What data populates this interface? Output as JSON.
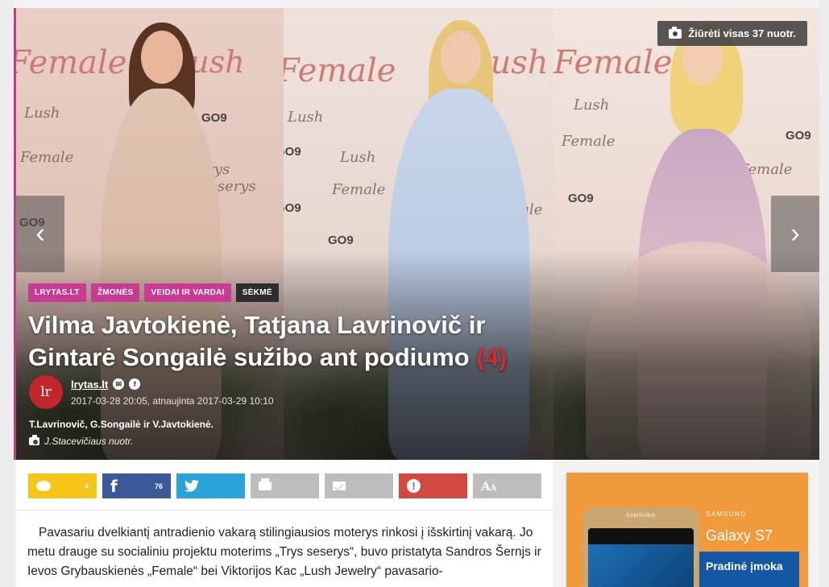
{
  "gallery": {
    "button_label": "Žiūrėti visas 37 nuotr.",
    "prev_arrow": "‹",
    "next_arrow": "›",
    "backdrop_brand_1": "Female",
    "backdrop_brand_2": "Lush",
    "backdrop_brand_3": "GO9",
    "backdrop_brand_4": "trys seserys"
  },
  "tags": [
    "LRYTAS.LT",
    "ŽMONĖS",
    "VEIDAI IR VARDAI",
    "SĖKMĖ"
  ],
  "article": {
    "title": "Vilma Javtokienė, Tatjana Lavrinovič ir Gintarė Songailė sužibo ant podiumo",
    "comment_count": "(4)",
    "author": "lrytas.lt",
    "author_logo": "lr",
    "dates": "2017-03-28 20:05, atnaujinta 2017-03-29 10:10",
    "photo_caption": "T.Lavrinovič, G.Songailė ir V.Javtokienė.",
    "photo_credit": "J.Stacevičiaus nuotr.",
    "body": "Pavasariu dvelkiantį antradienio vakarą stilingiausios moterys rinkosi į išskirtinį vakarą. Jo metu drauge su socialiniu projektu moterims „Trys seserys“, buvo pristatyta Sandros Šernjs ir Ievos Grybauskienės „Female“ bei Viktorijos Kac „Lush Jewelry“ pavasario-"
  },
  "share": {
    "comments_count": "4",
    "facebook_count": "76",
    "facebook_glyph": "f",
    "twitter_glyph": "🐦",
    "report_glyph": "!",
    "font_glyph_big": "A",
    "font_glyph_small": "A"
  },
  "ad": {
    "phone_brand": "SAMSUNG",
    "brand": "SAMSUNG",
    "model": "Galaxy S7",
    "cta": "Pradinė įmoka"
  },
  "colors": {
    "tag_pink": "#c93a94",
    "comments": "#f5c518",
    "facebook": "#3b5998",
    "twitter": "#2aa3d8",
    "report": "#d24a3f",
    "ad_orange": "#f19a3b"
  }
}
